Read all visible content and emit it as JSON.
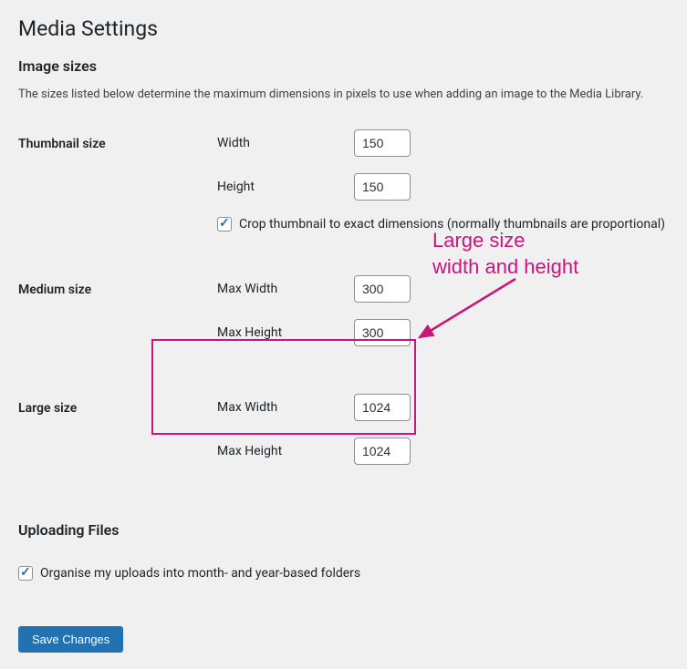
{
  "page_title": "Media Settings",
  "image_sizes": {
    "heading": "Image sizes",
    "description": "The sizes listed below determine the maximum dimensions in pixels to use when adding an image to the Media Library."
  },
  "thumbnail": {
    "label": "Thumbnail size",
    "width_label": "Width",
    "width_value": "150",
    "height_label": "Height",
    "height_value": "150",
    "crop_label": "Crop thumbnail to exact dimensions (normally thumbnails are proportional)",
    "crop_checked": true
  },
  "medium": {
    "label": "Medium size",
    "max_width_label": "Max Width",
    "max_width_value": "300",
    "max_height_label": "Max Height",
    "max_height_value": "300"
  },
  "large": {
    "label": "Large size",
    "max_width_label": "Max Width",
    "max_width_value": "1024",
    "max_height_label": "Max Height",
    "max_height_value": "1024"
  },
  "uploading": {
    "heading": "Uploading Files",
    "organise_label": "Organise my uploads into month- and year-based folders",
    "organise_checked": true
  },
  "save_label": "Save Changes",
  "annotation": {
    "line1": "Large size",
    "line2": "width and height"
  }
}
